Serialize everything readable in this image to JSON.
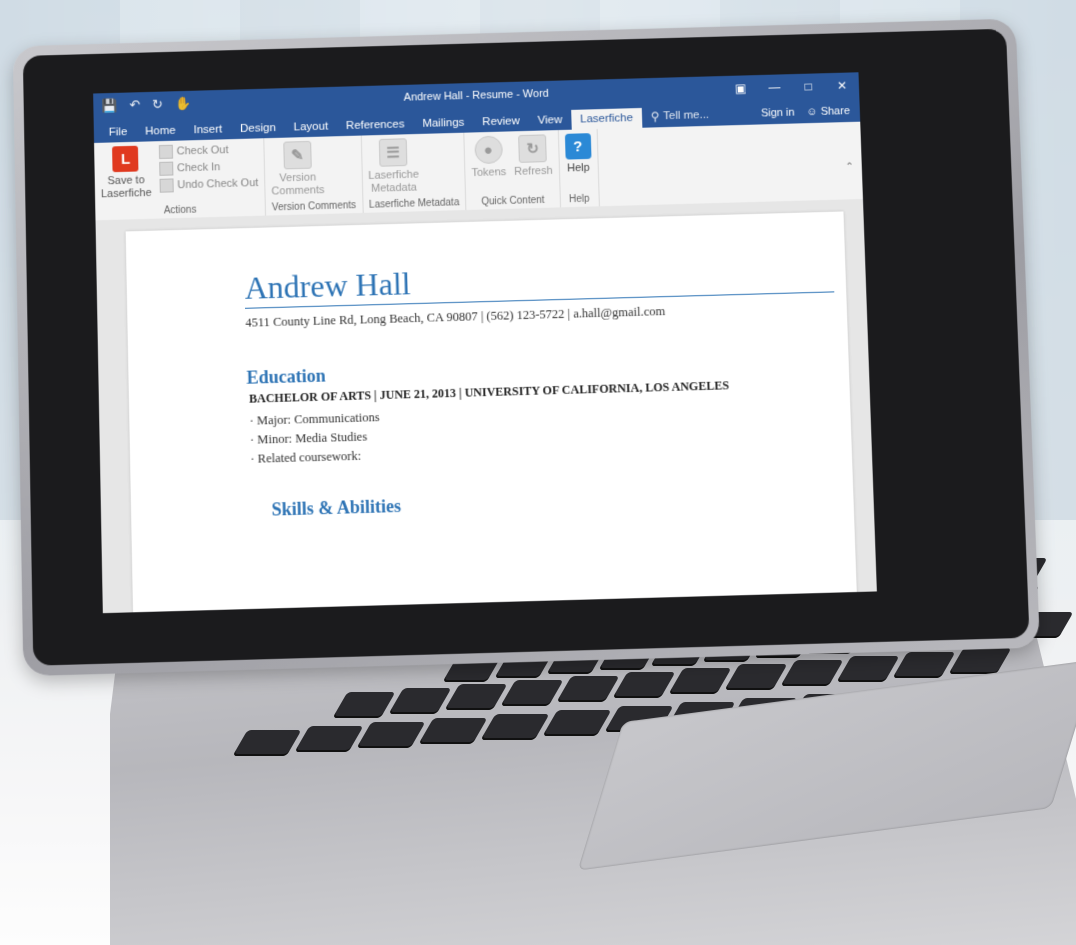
{
  "window": {
    "title": "Andrew Hall - Resume - Word",
    "controls": [
      "restore-icon",
      "minimize-icon",
      "maximize-icon",
      "close-icon"
    ]
  },
  "quick_access": [
    "save-icon",
    "undo-icon",
    "redo-icon",
    "touch-mode-icon"
  ],
  "tabs": [
    {
      "label": "File"
    },
    {
      "label": "Home"
    },
    {
      "label": "Insert"
    },
    {
      "label": "Design"
    },
    {
      "label": "Layout"
    },
    {
      "label": "References"
    },
    {
      "label": "Mailings"
    },
    {
      "label": "Review"
    },
    {
      "label": "View"
    },
    {
      "label": "Laserfiche"
    }
  ],
  "tell_me": "Tell me...",
  "sign_in": "Sign in",
  "share": "Share",
  "ribbon": {
    "actions": {
      "save_label_line1": "Save to",
      "save_label_line2": "Laserfiche",
      "check_out": "Check Out",
      "check_in": "Check In",
      "undo_check_out": "Undo Check Out",
      "group_label": "Actions"
    },
    "version_comments": {
      "btn_line1": "Version",
      "btn_line2": "Comments",
      "group_label": "Version Comments"
    },
    "metadata": {
      "btn_line1": "Laserfiche",
      "btn_line2": "Metadata",
      "group_label": "Laserfiche Metadata"
    },
    "quick_content": {
      "tokens": "Tokens",
      "refresh": "Refresh",
      "group_label": "Quick Content"
    },
    "help": {
      "btn": "Help",
      "group_label": "Help"
    }
  },
  "document": {
    "name": "Andrew Hall",
    "contact": "4511 County Line Rd, Long Beach, CA 90807 | (562) 123-5722 | a.hall@gmail.com",
    "education_heading": "Education",
    "degree_line": "BACHELOR OF ARTS | JUNE 21, 2013 | UNIVERSITY OF CALIFORNIA, LOS ANGELES",
    "bullets": [
      "Major: Communications",
      "Minor: Media Studies",
      "Related coursework:"
    ],
    "skills_heading": "Skills & Abilities"
  },
  "colors": {
    "word_blue": "#2b579a",
    "heading_blue": "#2e74b5",
    "laserfiche_red": "#e0391f"
  }
}
